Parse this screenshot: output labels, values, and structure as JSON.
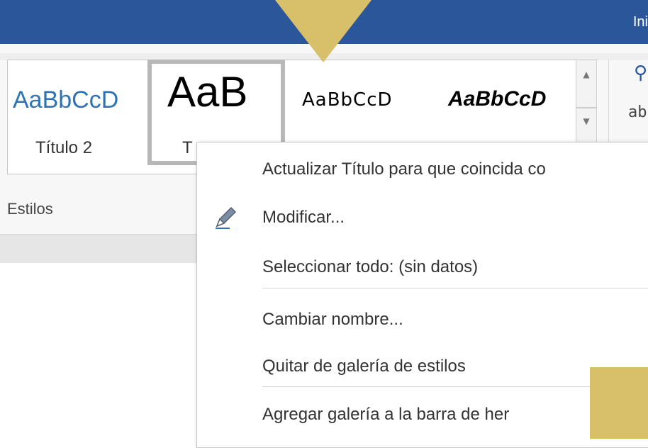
{
  "titlebar": {
    "title": "Ini"
  },
  "styles_gallery": {
    "samples": [
      "AaBbCcD",
      "AaB",
      "AaBbCcD",
      "AaBbCcD"
    ],
    "names": [
      "Título 2",
      "T"
    ],
    "selected_index": 1
  },
  "ribbon": {
    "group_label": "Estilos"
  },
  "context_menu": {
    "items": [
      "Actualizar Título para que coincida co",
      "Modificar...",
      "Seleccionar todo: (sin datos)",
      "Cambiar nombre...",
      "Quitar de galería de estilos",
      "Agregar galería a la barra de her"
    ]
  },
  "icons": {
    "scroll_up": "chevron-up-icon",
    "scroll_more": "chevron-down-icon",
    "find": "search-icon",
    "replace": "replace-icon",
    "modify": "pencil-icon"
  },
  "colors": {
    "accent": "#2b579a",
    "marker": "#d8c06a",
    "heading": "#2e74b5"
  }
}
